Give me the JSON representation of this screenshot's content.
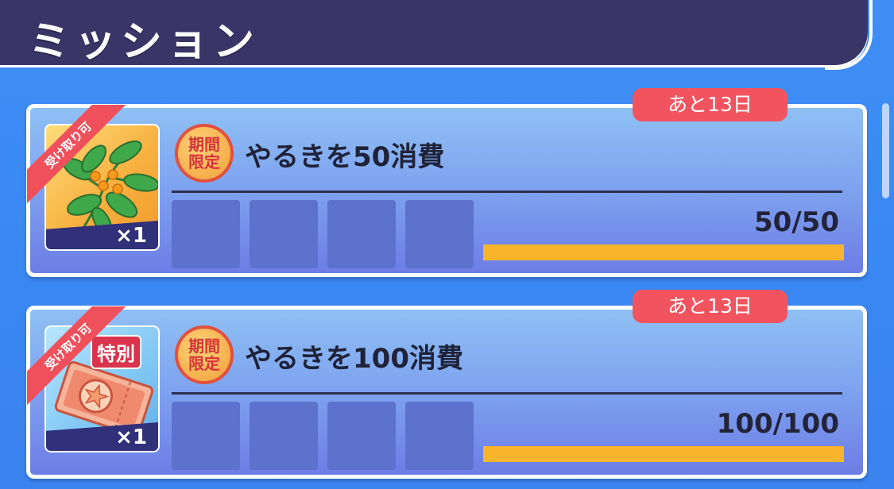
{
  "header": {
    "title": "ミッション"
  },
  "missions": [
    {
      "deadline": "あと13日",
      "status_ribbon": "受け取り可",
      "limited_badge": "期間限定",
      "title": "やるきを50消費",
      "reward": {
        "icon": "plant-icon",
        "quantity": "×1"
      },
      "progress_text": "50/50",
      "progress": 1.0
    },
    {
      "deadline": "あと13日",
      "status_ribbon": "受け取り可",
      "limited_badge": "期間限定",
      "title": "やるきを100消費",
      "reward": {
        "icon": "special-ticket-icon",
        "special_tag": "特別",
        "quantity": "×1"
      },
      "progress_text": "100/100",
      "progress": 1.0
    }
  ],
  "colors": {
    "background": "#3f8ef5",
    "header": "#3a3567",
    "deadline": "#f2545f",
    "progress_fill": "#f8b52b"
  }
}
